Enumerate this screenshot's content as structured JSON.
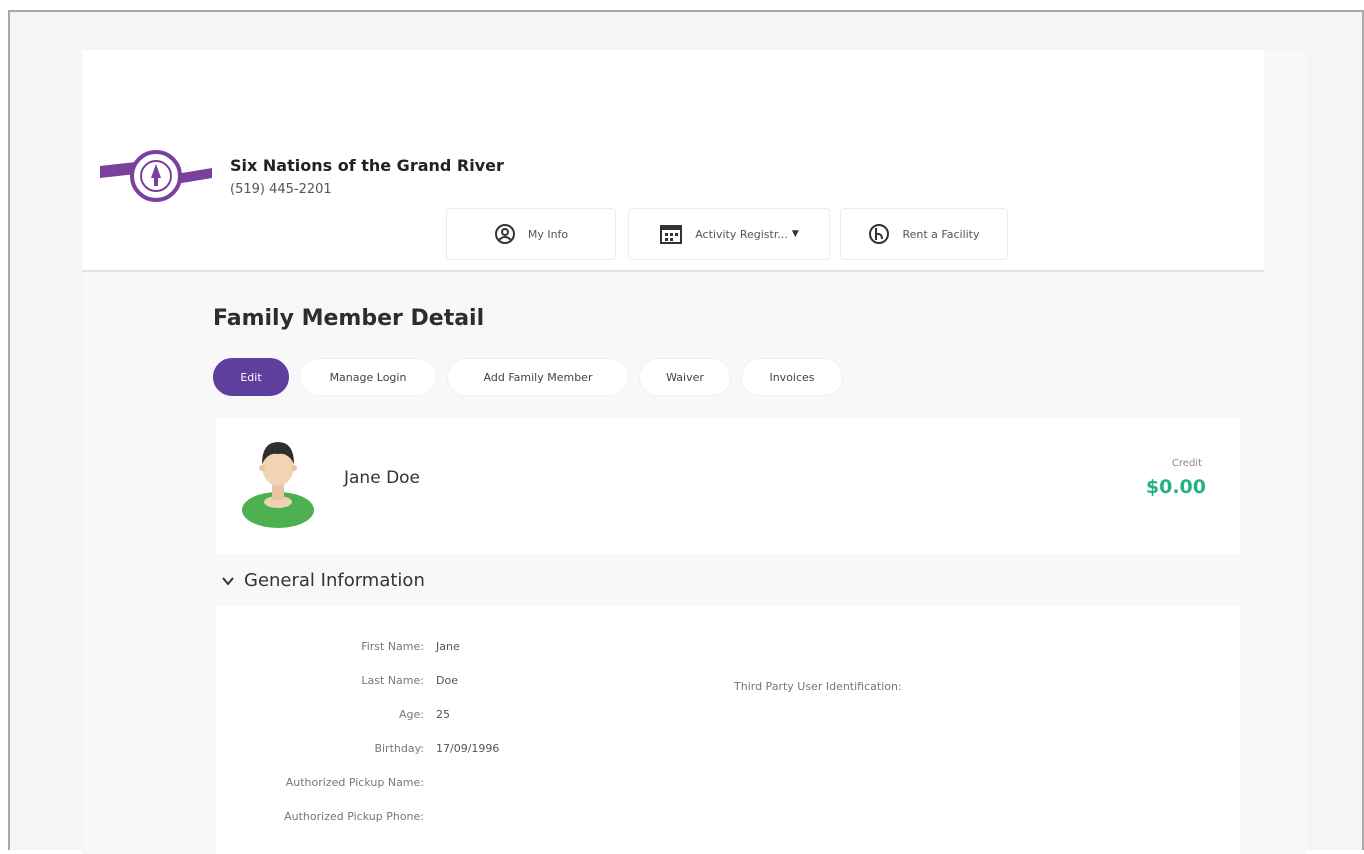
{
  "header": {
    "org_name": "Six Nations of the Grand River",
    "phone": "(519) 445-2201",
    "nav": {
      "my_info": "My Info",
      "activity": "Activity Registr...",
      "rent": "Rent a Facility"
    }
  },
  "page": {
    "title": "Family Member Detail",
    "tabs": {
      "edit": "Edit",
      "manage_login": "Manage Login",
      "add_family_member": "Add Family Member",
      "waiver": "Waiver",
      "invoices": "Invoices"
    }
  },
  "member": {
    "name": "Jane Doe",
    "credit_label": "Credit",
    "credit_value": "$0.00"
  },
  "general": {
    "section_title": "General Information",
    "fields": [
      {
        "label": "First Name:",
        "value": "Jane"
      },
      {
        "label": "Last Name:",
        "value": "Doe"
      },
      {
        "label": "Age:",
        "value": "25"
      },
      {
        "label": "Birthday:",
        "value": "17/09/1996"
      },
      {
        "label": "Authorized Pickup Name:",
        "value": ""
      },
      {
        "label": "Authorized Pickup Phone:",
        "value": ""
      }
    ],
    "third_party_label": "Third Party User Identification:"
  },
  "colors": {
    "accent": "#5e3f9d",
    "credit": "#25b283",
    "logo": "#7b3f9e"
  },
  "icons": {
    "my_info": "user-circle-icon",
    "activity": "calendar-icon",
    "rent": "facility-icon",
    "section": "chevron-down-icon"
  }
}
